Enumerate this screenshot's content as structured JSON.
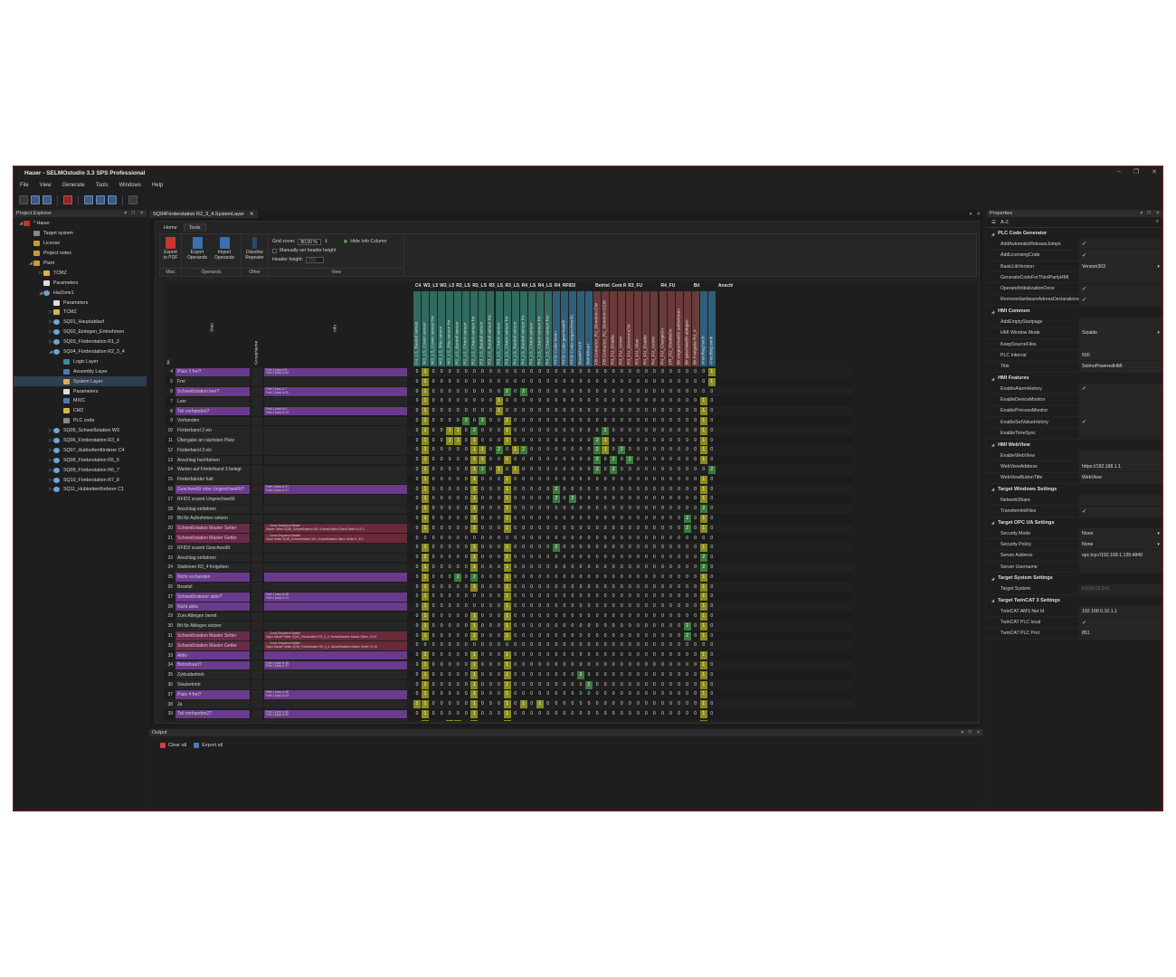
{
  "title": "Hauer - SELMOstudio 3.3 SPS Professional",
  "menu": [
    "File",
    "View",
    "Generate",
    "Tools",
    "Windows",
    "Help"
  ],
  "explorer": {
    "title": "Project Explorer",
    "items": [
      {
        "label": "* Hauer",
        "level": 0,
        "icon": "project-icon"
      },
      {
        "label": "Target system",
        "level": 1,
        "icon": "target-icon"
      },
      {
        "label": "License",
        "level": 1,
        "icon": "license-icon"
      },
      {
        "label": "Project notes",
        "level": 1,
        "icon": "notes-icon"
      },
      {
        "label": "Plant",
        "level": 1,
        "icon": "plant-icon"
      },
      {
        "label": "TCMZ",
        "level": 2,
        "icon": "folder-icon"
      },
      {
        "label": "Parameters",
        "level": 2,
        "icon": "param-icon"
      },
      {
        "label": "HwZone1",
        "level": 2,
        "icon": "zone-icon"
      },
      {
        "label": "Parameters",
        "level": 3,
        "icon": "param-icon"
      },
      {
        "label": "TCMZ",
        "level": 3,
        "icon": "folder-icon"
      },
      {
        "label": "SQ01_Hauptablauf",
        "level": 3,
        "icon": "sq-icon"
      },
      {
        "label": "SQ02_Einlegen_Entnehmen",
        "level": 3,
        "icon": "sq-icon"
      },
      {
        "label": "SQ03_Förderstation R1_2",
        "level": 3,
        "icon": "sq-icon"
      },
      {
        "label": "SQ04_Förderstation R2_3_4",
        "level": 3,
        "icon": "sq-icon"
      },
      {
        "label": "Logic Layer",
        "level": 4,
        "icon": "logic-layer-icon"
      },
      {
        "label": "Assembly Layer",
        "level": 4,
        "icon": "assembly-layer-icon"
      },
      {
        "label": "System Layer",
        "level": 4,
        "icon": "system-layer-icon",
        "selected": true
      },
      {
        "label": "Parameters",
        "level": 4,
        "icon": "param-icon"
      },
      {
        "label": "MXIC",
        "level": 4,
        "icon": "mxic-icon"
      },
      {
        "label": "CMZ",
        "level": 4,
        "icon": "folder-icon"
      },
      {
        "label": "PLC code",
        "level": 4,
        "icon": "plc-code-icon"
      },
      {
        "label": "SQ05_Schweißstation W3",
        "level": 3,
        "icon": "sq-icon"
      },
      {
        "label": "SQ06_Förderstation R3_4",
        "level": 3,
        "icon": "sq-icon"
      },
      {
        "label": "SQ07_Hubkettenförderer C4",
        "level": 3,
        "icon": "sq-icon"
      },
      {
        "label": "SQ08_Förderstation R5_6",
        "level": 3,
        "icon": "sq-icon"
      },
      {
        "label": "SQ09_Förderstation R6_7",
        "level": 3,
        "icon": "sq-icon"
      },
      {
        "label": "SQ10_Förderstation R7_8",
        "level": 3,
        "icon": "sq-icon"
      },
      {
        "label": "SQ11_Hubkettenförderer C1",
        "level": 3,
        "icon": "sq-icon"
      }
    ]
  },
  "document": {
    "tab": "SQ04Förderstation R2_3_4.SystemLayer",
    "ribbon_tabs": [
      "Home",
      "Tools"
    ],
    "ribbon": {
      "misc_label": "Misc",
      "operands_label": "Operands",
      "other_label": "Other",
      "view_label": "View",
      "export_pdf": "Export to PDF",
      "export_operands": "Export Operands",
      "import_operands": "Import Operands",
      "dissolve": "Dissolve Repeater",
      "grid_zoom_label": "Grid zoom:",
      "grid_zoom_value": "80,00 %",
      "manual_header": "Manually set header height",
      "header_height_label": "Header height:",
      "header_height_value": "150",
      "hide_info": "Hide Info Column"
    },
    "col_headers": {
      "nr": "Nr.",
      "step": "Step",
      "group": "GroupName",
      "info": "Info"
    }
  },
  "grid": {
    "groups": [
      {
        "label": "C4_",
        "span": 1
      },
      {
        "label": "W3_LS_",
        "span": 2
      },
      {
        "label": "W3_LS_",
        "span": 2
      },
      {
        "label": "R2_LS_I",
        "span": 2
      },
      {
        "label": "R2_LS_I",
        "span": 2
      },
      {
        "label": "R3_LS_!",
        "span": 2
      },
      {
        "label": "R3_LS_!",
        "span": 2
      },
      {
        "label": "R4_LS_I",
        "span": 2
      },
      {
        "label": "R4_LS_I",
        "span": 2
      },
      {
        "label": "R4_LS_(",
        "span": 1
      },
      {
        "label": "RFID2",
        "span": 4
      },
      {
        "label": "Betrieb",
        "span": 2
      },
      {
        "label": "Cont R:",
        "span": 2
      },
      {
        "label": "R3_FU",
        "span": 4
      },
      {
        "label": "R4_FU",
        "span": 4
      },
      {
        "label": "Bit",
        "span": 3
      },
      {
        "label": "Anschla",
        "span": 2
      }
    ],
    "columns": [
      "C4_LS_Bauteil sensor",
      "W3_LS_Cover sensor",
      "W3_LS_Cover sensor fre",
      "W3_LS_Bhp sensor",
      "W3_LS_Bhp sensor fre",
      "R2_LS_Bauteil sensor",
      "R2_LS_Check sensor",
      "R2_LS_Check sensor fre",
      "R3_LS_Bauteil sensor",
      "R3_LS_Bauteil sensor fre",
      "R3_LS_Check sensor",
      "R3_LS_Check sensor fre",
      "R4_LS_Bauteil sensor",
      "R4_LS_Bauteil sensor fre",
      "R4_LS_Check sensor",
      "R4_LS_Check sensor fre",
      "R4_LS_Check sensor frei",
      "RFID Code lesen",
      "RFID Code geschweißt",
      "RFID Code ungeschweißt",
      "Bauteil vorh",
      "Betriebsart",
      "FB Contactor_R2_Direction CW",
      "FB Contactor_R2_Direction CCW",
      "R3_FU_Enable",
      "R3_FU_Active",
      "R3_FU_DirectionCW",
      "R3_FU_Slow",
      "R4_FU_Enable",
      "R4_FU_Active",
      "R4_FU_ChargeOn",
      "FR_FU_ShuttleOn",
      "Bit ungeschweißt aufnehmen",
      "Bit geschweißt ablegen",
      "Bit Freigabe R3_4",
      "Anschlag hoch",
      "Anschlag senk"
    ],
    "rows": [
      {
        "nr": "4",
        "step": "Platz 3 frei?",
        "info": "Path 1 jump to 5\nPath 2 jump to 53",
        "purple": true,
        "v": "01000000000000000000000000000000000010"
      },
      {
        "nr": "5",
        "step": "Frei",
        "v": "01000000000000000000000000000000000010"
      },
      {
        "nr": "6",
        "step": "Schweißstation leer?",
        "info": "Path 1 jump to 7\nPath 2 jump to 30",
        "purple": true,
        "v": "0100000000020200000000000000000000000"
      },
      {
        "nr": "7",
        "step": "Leer",
        "v": "0100000000100000000000000000000000010"
      },
      {
        "nr": "8",
        "step": "Teil vorhanden?",
        "info": "Path 1 jump to 9\nPath 2 jump to 23",
        "purple": true,
        "v": "0100000000100000000000000000000000010"
      },
      {
        "nr": "9",
        "step": "Vorhanden",
        "v": "0100002020010000000000000000000000010"
      },
      {
        "nr": "10",
        "step": "Förderband 2 ein",
        "v": "0100110200010000000000020000000000010"
      },
      {
        "nr": "11",
        "step": "Übergabe an nächsten Platz",
        "v": "0100110100010000000000210000000000010"
      },
      {
        "nr": "12",
        "step": "Förderband 3 ein",
        "v": "0100000110201200000000210200000000010"
      },
      {
        "nr": "13",
        "step": "Anschlag hochfahren",
        "v": "0100000110010000000000202020000000010"
      },
      {
        "nr": "14",
        "step": "Warten auf Förderband 3 belegt",
        "v": "0100000120101000000000202000000000002"
      },
      {
        "nr": "15",
        "step": "Förderbänder halt",
        "v": "0100000100010000000000000000000000010"
      },
      {
        "nr": "16",
        "step": "Geschweißt oder Ungeschweißt?",
        "info": "Path 1 jump to 17\nPath 2 jump to 27",
        "purple": true,
        "v": "0100000100010000020000000000000000010"
      },
      {
        "nr": "17",
        "step": "RFID2 scannt Ungeschweißt",
        "v": "0100000100010000020200000000000000010"
      },
      {
        "nr": "18",
        "step": "Anschlag einfahren",
        "v": "0100000100010000000000000000000000020"
      },
      {
        "nr": "19",
        "step": "Bit für Aufnehmen setzen",
        "v": "0100000100010000000000000000000002010"
      },
      {
        "nr": "20",
        "step": "Schweißstation Master Setter",
        "info": "→ Cross Sequence Master\nMaster Setter SQ05_Schweißstation W3, Schweißstation Slave Setter 8, ID:1",
        "purple": true,
        "red": true,
        "v": "0100000100010000000000000000000002010"
      },
      {
        "nr": "21",
        "step": "Schweißstation Master Getter",
        "info": "← Cross Sequence Master\nSlave Setter SQ05_Schweißstation W3, Schweißstation Slave Getter 8, ID:2",
        "purple": true,
        "red": true,
        "v": "0000000000000000000000000000000000000"
      },
      {
        "nr": "22",
        "step": "RFID2 scannt Geschweißt",
        "v": "0100000100010000020000000000000000010"
      },
      {
        "nr": "23",
        "step": "Anschlag einfahren",
        "v": "0100000100010000000000000000000000020"
      },
      {
        "nr": "24",
        "step": "Stationen R3_4 freigeben",
        "v": "0100000100010000000000000000000000020"
      },
      {
        "nr": "25",
        "step": "Nicht vorhanden",
        "purple": true,
        "v": "0100020200010000000000000000000000010"
      },
      {
        "nr": "26",
        "step": "Besetzt",
        "v": "0100000100010000000000000000000000010"
      },
      {
        "nr": "27",
        "step": "Schweißroboter aktiv?",
        "info": "Path 1 jump to 28\nPath 2 jump to 31",
        "purple": true,
        "v": "0100000000010000000000000000000000010"
      },
      {
        "nr": "28",
        "step": "Nicht aktiv",
        "purple": true,
        "v": "0100000000010000000000000000000000010"
      },
      {
        "nr": "29",
        "step": "Zum Ablegen bereit",
        "v": "0100000100010000000000000000000000010"
      },
      {
        "nr": "30",
        "step": "Bit für Ablegen setzen",
        "v": "0100000100010000000000000000000002010"
      },
      {
        "nr": "31",
        "step": "Schweißstation Master Setter",
        "info": "→ Cross Sequence Master\nMajor Master Setter SQ04_Förderstation R2_3_4, Schweißstation Master Setter, ID:15",
        "purple": true,
        "red": true,
        "v": "0100000100010000000000000000000002010"
      },
      {
        "nr": "32",
        "step": "Schweißstation Master Getter",
        "info": "← Cross Sequence Master\nMajor Master Getter SQ04_Förderstation R2_3_4, Schweißstation Master Getter, ID:16",
        "purple": true,
        "red": true,
        "v": "0000000000000000000000000000000000000"
      },
      {
        "nr": "33",
        "step": "Aktiv",
        "purple": true,
        "v": "0100000100010000000000000000000000010"
      },
      {
        "nr": "34",
        "step": "Betriebsart?",
        "info": "Path 1 jump to 35\nPath 2 jump to 37",
        "purple": true,
        "v": "0100000100010000000000000000000000010"
      },
      {
        "nr": "35",
        "step": "Zyklusbetrieb",
        "v": "0100000100010000000020000000000000010"
      },
      {
        "nr": "36",
        "step": "Staubetrieb",
        "v": "0100000100010000000002000000000000010"
      },
      {
        "nr": "37",
        "step": "Platz 4 frei?",
        "info": "Path 1 jump to 38\nPath 2 jump to 53",
        "purple": true,
        "v": "0100000100010000000000000000000000010"
      },
      {
        "nr": "38",
        "step": "Ja",
        "v": "1100000100010101000000000000000000010"
      },
      {
        "nr": "39",
        "step": "Teil vorhanden2?",
        "info": "Path 1 jump to 40\nPath 2 jump to 50",
        "purple": true,
        "v": "0100000100010000000000000000000000010"
      },
      {
        "nr": "40",
        "step": "Vorhanden",
        "v": "0100110100010000000000000000000000010"
      }
    ]
  },
  "output": {
    "title": "Output",
    "clear": "Clear all",
    "export": "Export all"
  },
  "properties": {
    "title": "Properties",
    "sort": "A-Z",
    "sections": [
      {
        "name": "PLC Code Generator",
        "props": [
          [
            "AddAutomaticReleaseJumps",
            "✓"
          ],
          [
            "AddLicensingCode",
            "✓"
          ],
          [
            "BasicLibVersion",
            "Version303"
          ],
          [
            "GenerateCodeForThirdPartyHMI",
            ""
          ],
          [
            "OperandInitializationOnce",
            "✓"
          ],
          [
            "RemoveHardwareAdressDeclarations",
            "✓"
          ]
        ]
      },
      {
        "name": "HMI Common",
        "props": [
          [
            "AddEmptyStartpage",
            ""
          ],
          [
            "HMI Window Mode",
            "Sizable"
          ],
          [
            "KeepSourceFiles",
            ""
          ],
          [
            "PLC Interval",
            "500"
          ],
          [
            "Title",
            "SelmoPoweredHMI"
          ]
        ]
      },
      {
        "name": "HMI Features",
        "props": [
          [
            "EnableAlarmHistory",
            "✓"
          ],
          [
            "EnableDeviceMonitor",
            ""
          ],
          [
            "EnableProcessMonitor",
            ""
          ],
          [
            "EnableSetValueHistory",
            "✓"
          ],
          [
            "EnableTimeSync",
            ""
          ]
        ]
      },
      {
        "name": "HMI WebView",
        "props": [
          [
            "EnableWebView",
            ""
          ],
          [
            "WebViewAddress",
            "https://192.168.1.1"
          ],
          [
            "WebViewButtonTitle",
            "WebView"
          ]
        ]
      },
      {
        "name": "Target Windows Settings",
        "props": [
          [
            "NetworkShare",
            ""
          ],
          [
            "TransferHmiFiles",
            "✓"
          ]
        ]
      },
      {
        "name": "Target OPC UA Settings",
        "props": [
          [
            "Security Mode",
            "None"
          ],
          [
            "Security Policy",
            "None"
          ],
          [
            "Server Address",
            "opc.tcp://192.168.1.135:4840"
          ],
          [
            "Server Username",
            ""
          ]
        ]
      },
      {
        "name": "Target System Settings",
        "props": [
          [
            "Target System",
            "KESA DL3x0"
          ]
        ]
      },
      {
        "name": "Target TwinCAT 3 Settings",
        "props": [
          [
            "TwinCAT AMS Net Id",
            "192.168.0.10.1.1"
          ],
          [
            "TwinCAT PLC local",
            "✓"
          ],
          [
            "TwinCAT PLC Port",
            "851"
          ]
        ]
      }
    ]
  },
  "colors": {
    "purple": "#6a3b8c",
    "red_row": "#6a2a3a",
    "green_col": "#2f6b5f",
    "red_col": "#6b3a3a",
    "blue_col": "#2e5f7a",
    "yellow": "#8a8a20",
    "green": "#3a7a3a"
  }
}
